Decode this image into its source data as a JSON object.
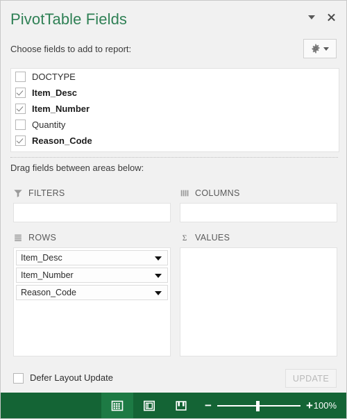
{
  "pane": {
    "title": "PivotTable Fields",
    "collapse_icon": "chevron-down-icon",
    "close_icon": "close-icon",
    "choose_label": "Choose fields to add to report:",
    "tools_icon": "gear-icon"
  },
  "field_list": {
    "fields": [
      {
        "name": "DOCTYPE",
        "checked": false
      },
      {
        "name": "Item_Desc",
        "checked": true
      },
      {
        "name": "Item_Number",
        "checked": true
      },
      {
        "name": "Quantity",
        "checked": false
      },
      {
        "name": "Reason_Code",
        "checked": true
      }
    ]
  },
  "drag_label": "Drag fields between areas below:",
  "areas": {
    "filters": {
      "label": "FILTERS",
      "icon": "funnel-icon",
      "items": []
    },
    "columns": {
      "label": "COLUMNS",
      "icon": "columns-icon",
      "items": []
    },
    "rows": {
      "label": "ROWS",
      "icon": "rows-icon",
      "items": [
        {
          "label": "Item_Desc"
        },
        {
          "label": "Item_Number"
        },
        {
          "label": "Reason_Code"
        }
      ]
    },
    "values": {
      "label": "VALUES",
      "icon": "sigma-icon",
      "items": []
    }
  },
  "footer": {
    "defer_label": "Defer Layout Update",
    "defer_checked": false,
    "update_label": "UPDATE",
    "update_enabled": false
  },
  "statusbar": {
    "views": [
      {
        "name": "normal-view",
        "icon": "grid-icon",
        "active": true
      },
      {
        "name": "page-layout-view",
        "icon": "page-layout-icon",
        "active": false
      },
      {
        "name": "page-break-view",
        "icon": "page-break-icon",
        "active": false
      }
    ],
    "zoom_out_label": "−",
    "zoom_in_label": "+",
    "zoom_percent": "100%",
    "zoom_value": 100
  },
  "colors": {
    "brand_green": "#2f8055",
    "statusbar_green": "#146435",
    "statusbar_active": "#1d7a44",
    "panel_bg": "#f1f1f1",
    "box_bg": "#ffffff"
  }
}
